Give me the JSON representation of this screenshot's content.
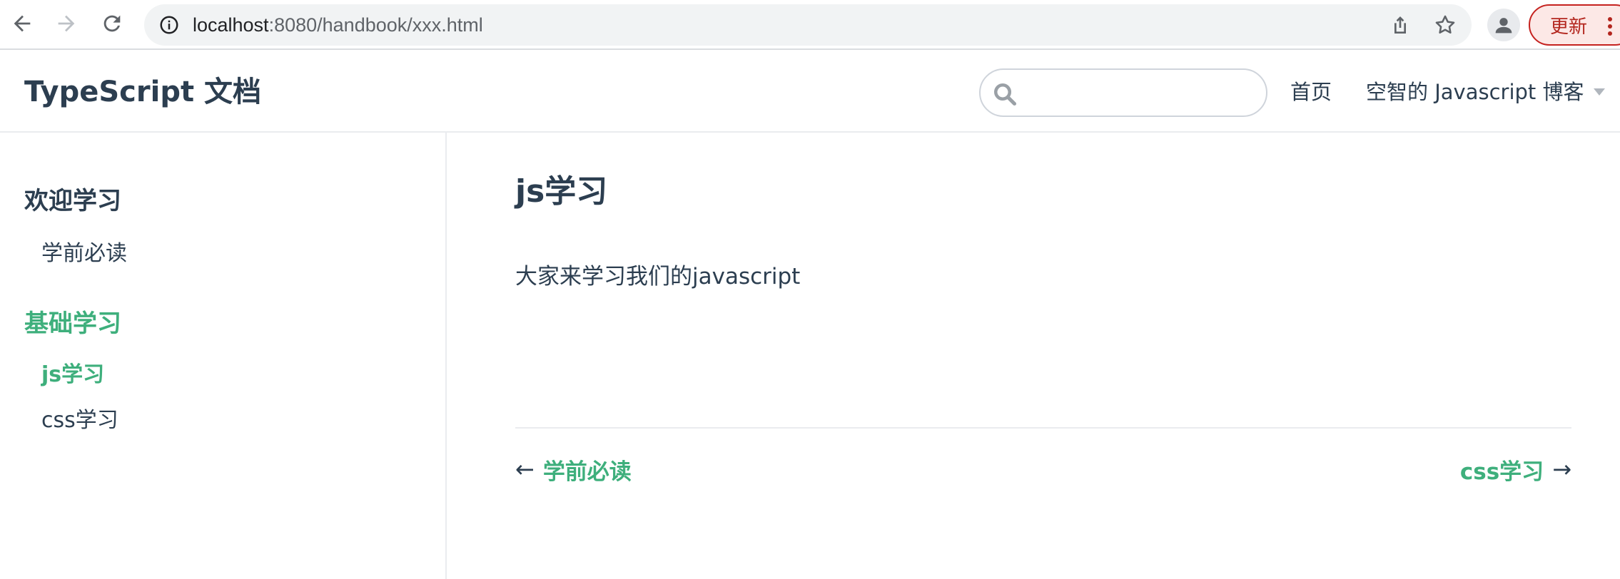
{
  "browser": {
    "url_host": "localhost",
    "url_path": ":8080/handbook/xxx.html",
    "update_label": "更新",
    "icons": {
      "back": "back-arrow-icon",
      "forward": "forward-arrow-icon",
      "reload": "reload-icon",
      "info": "info-icon",
      "share": "share-icon",
      "bookmark": "star-icon",
      "profile": "profile-icon",
      "menu": "more-vert-icon"
    }
  },
  "navbar": {
    "site_title": "TypeScript 文档",
    "search_placeholder": "",
    "links": [
      {
        "label": "首页"
      },
      {
        "label": "空智的 Javascript 博客"
      }
    ]
  },
  "sidebar": {
    "groups": [
      {
        "title": "欢迎学习",
        "active": false,
        "items": [
          {
            "label": "学前必读",
            "active": false
          }
        ]
      },
      {
        "title": "基础学习",
        "active": true,
        "items": [
          {
            "label": "js学习",
            "active": true
          },
          {
            "label": "css学习",
            "active": false
          }
        ]
      }
    ]
  },
  "content": {
    "title": "js学习",
    "paragraph": "大家来学习我们的javascript",
    "prev": {
      "arrow": "←",
      "label": "学前必读"
    },
    "next": {
      "arrow": "→",
      "label": "css学习"
    }
  },
  "colors": {
    "accent": "#3eaf7c",
    "text": "#2c3e50",
    "border": "#eaecef",
    "update_red": "#c5221f"
  }
}
